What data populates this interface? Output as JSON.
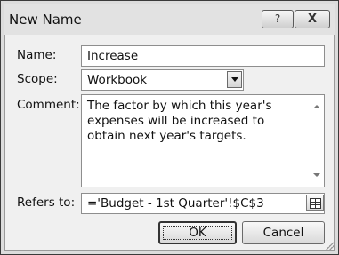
{
  "window": {
    "title": "New Name",
    "help_label": "?",
    "close_label": "X"
  },
  "form": {
    "name_label": "Name:",
    "name_value": "Increase",
    "scope_label": "Scope:",
    "scope_value": "Workbook",
    "comment_label": "Comment:",
    "comment_value": "The factor by which this year's expenses will be increased to obtain next year's targets.",
    "refers_label": "Refers to:",
    "refers_value": "='Budget - 1st Quarter'!$C$3"
  },
  "buttons": {
    "ok": "OK",
    "cancel": "Cancel"
  }
}
